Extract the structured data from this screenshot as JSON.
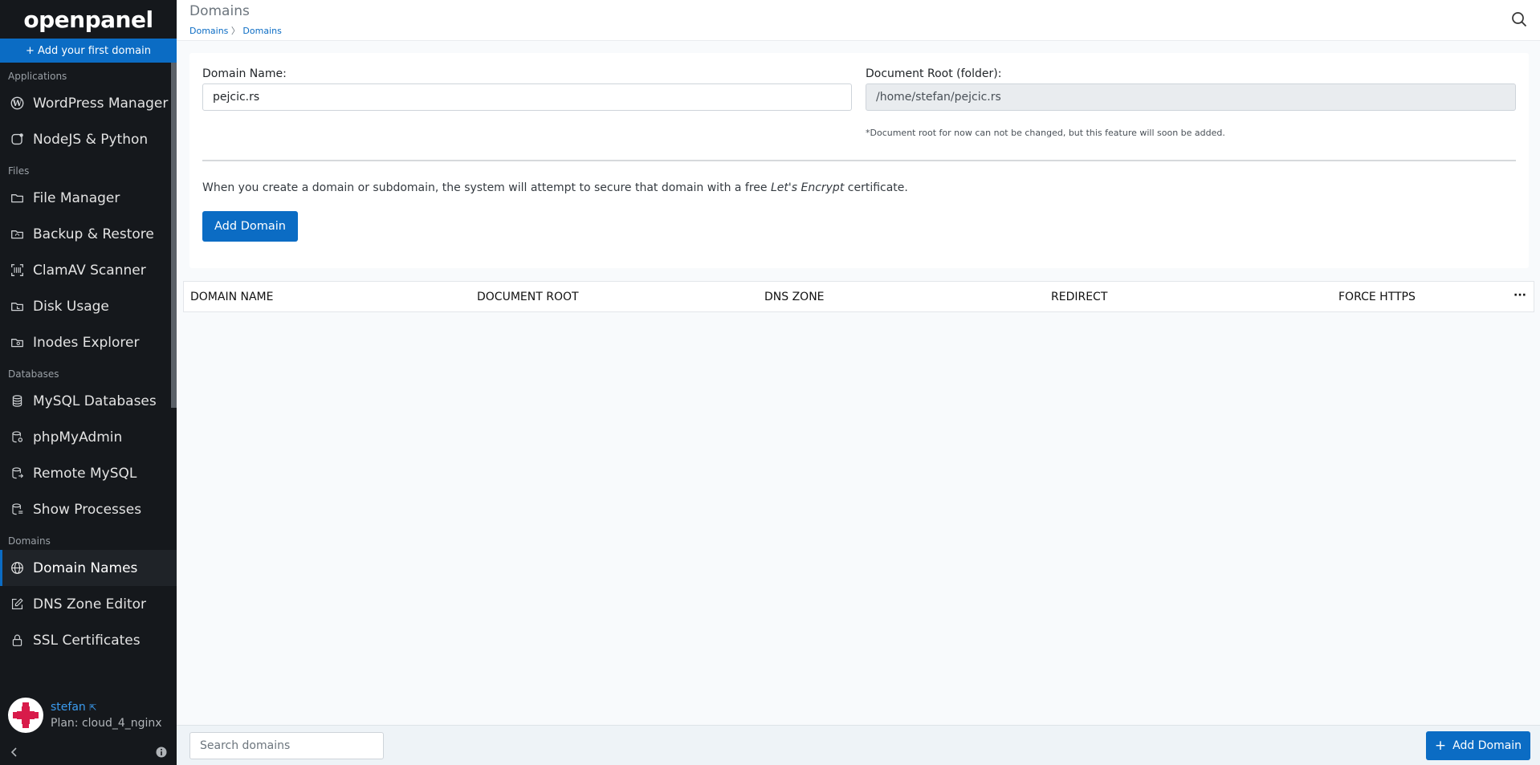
{
  "sidebar": {
    "logo": "openpanel",
    "add_first_domain": "+ Add your first domain",
    "sections": {
      "applications": "Applications",
      "files": "Files",
      "databases": "Databases",
      "domains": "Domains"
    },
    "items": {
      "wordpress": "WordPress Manager",
      "nodejs": "NodeJS & Python",
      "file_manager": "File Manager",
      "backup": "Backup & Restore",
      "clamav": "ClamAV Scanner",
      "disk_usage": "Disk Usage",
      "inodes": "Inodes Explorer",
      "mysql": "MySQL Databases",
      "phpmyadmin": "phpMyAdmin",
      "remote_mysql": "Remote MySQL",
      "processes": "Show Processes",
      "domain_names": "Domain Names",
      "dns_zone": "DNS Zone Editor",
      "ssl": "SSL Certificates"
    },
    "user": {
      "name": "stefan",
      "plan": "Plan: cloud_4_nginx"
    }
  },
  "header": {
    "title": "Domains",
    "breadcrumb": [
      "Domains",
      "Domains"
    ],
    "breadcrumb_sep": "〉"
  },
  "form": {
    "domain_label": "Domain Name:",
    "domain_value": "pejcic.rs",
    "docroot_label": "Document Root (folder):",
    "docroot_value": "/home/stefan/pejcic.rs",
    "docroot_note": "*Document root for now can not be changed, but this feature will soon be added.",
    "info_before": "When you create a domain or subdomain, the system will attempt to secure that domain with a free ",
    "info_em": "Let's Encrypt",
    "info_after": " certificate.",
    "submit_label": "Add Domain"
  },
  "table": {
    "columns": [
      "DOMAIN NAME",
      "DOCUMENT ROOT",
      "DNS ZONE",
      "REDIRECT",
      "FORCE HTTPS"
    ],
    "menu": "···"
  },
  "footer": {
    "search_placeholder": "Search domains",
    "add_label": "Add Domain"
  },
  "colors": {
    "accent": "#0b6cc4",
    "sidebar_bg": "#15181c"
  }
}
